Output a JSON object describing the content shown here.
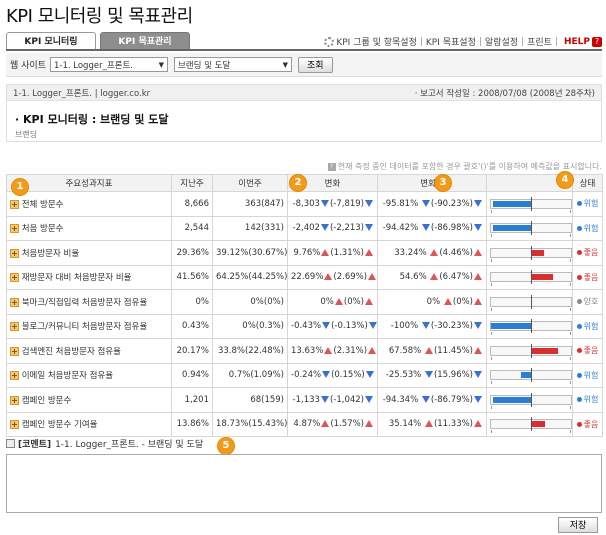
{
  "page_title": "KPI 모니터링 및 목표관리",
  "tabs": [
    {
      "label": "KPI 모니터링",
      "active": true
    },
    {
      "label": "KPI 목표관리",
      "active": false
    }
  ],
  "toplinks": {
    "group_settings": "KPI 그룹 및 항목설정",
    "goal_settings": "KPI 목표설정",
    "alarm_settings": "알람설정",
    "print": "프린트",
    "help": "HELP",
    "help_icon": "?"
  },
  "filter": {
    "site_label": "웹 사이트",
    "site_value": "1-1. Logger_프론트.",
    "category_value": "브랜딩 및 도달",
    "query_button": "조회"
  },
  "report": {
    "site_line": "1-1. Logger_프론트.  |  logger.co.kr",
    "date_line": "· 보고서 작성일 : 2008/07/08 (2008년 28주차)",
    "title": "· KPI 모니터링 : 브랜딩 및 도달",
    "subtitle": "브랜딩"
  },
  "note": "현재 측정 중인 데이터를 포함한 경우 괄호'()'를 이용하여 예측값을 표시합니다.",
  "note_icon": "!",
  "table": {
    "headers": [
      "주요성과지표",
      "지난주",
      "이번주",
      "변화",
      "변화율",
      "",
      "상태"
    ],
    "rows": [
      {
        "name": "전체 방문수",
        "prev": "8,666",
        "curr": "363(847)",
        "change": "-8,303",
        "change_pred": "(-7,819)",
        "rate": "-95.81%",
        "rate_pred": "(-90.23%)",
        "dir": "down",
        "bar": -0.96,
        "status": "위험"
      },
      {
        "name": "처음 방문수",
        "prev": "2,544",
        "curr": "142(331)",
        "change": "-2,402",
        "change_pred": "(-2,213)",
        "rate": "-94.42%",
        "rate_pred": "(-86.98%)",
        "dir": "down",
        "bar": -0.94,
        "status": "위험"
      },
      {
        "name": "처음방문자 비율",
        "prev": "29.36%",
        "curr": "39.12%(30.67%)",
        "change": "9.76%",
        "change_pred": "(1.31%)",
        "rate": "33.24%",
        "rate_pred": "(4.46%)",
        "dir": "up",
        "bar": 0.33,
        "status": "좋음"
      },
      {
        "name": "재방문자 대비 처음방문자 비율",
        "prev": "41.56%",
        "curr": "64.25%(44.25%)",
        "change": "22.69%",
        "change_pred": "(2.69%)",
        "rate": "54.6%",
        "rate_pred": "(6.47%)",
        "dir": "up",
        "bar": 0.55,
        "status": "좋음"
      },
      {
        "name": "북마크/직접입력 처음방문자 점유율",
        "prev": "0%",
        "curr": "0%(0%)",
        "change": "0%",
        "change_pred": "(0%)",
        "rate": "0%",
        "rate_pred": "(0%)",
        "dir": "flat",
        "bar": 0,
        "status": "양호"
      },
      {
        "name": "블로그/커뮤니티 처음방문자 점유율",
        "prev": "0.43%",
        "curr": "0%(0.3%)",
        "change": "-0.43%",
        "change_pred": "(-0.13%)",
        "rate": "-100%",
        "rate_pred": "(-30.23%)",
        "dir": "down",
        "bar": -1.0,
        "status": "위험"
      },
      {
        "name": "검색엔진 처음방문자 점유율",
        "prev": "20.17%",
        "curr": "33.8%(22.48%)",
        "change": "13.63%",
        "change_pred": "(2.31%)",
        "rate": "67.58%",
        "rate_pred": "(11.45%)",
        "dir": "up",
        "bar": 0.68,
        "status": "좋음"
      },
      {
        "name": "이메일 처음방문자 점유율",
        "prev": "0.94%",
        "curr": "0.7%(1.09%)",
        "change": "-0.24%",
        "change_pred": "(0.15%)",
        "rate": "-25.53%",
        "rate_pred": "(15.96%)",
        "dir": "down",
        "bar": -0.26,
        "status": "위험"
      },
      {
        "name": "캠페인 방문수",
        "prev": "1,201",
        "curr": "68(159)",
        "change": "-1,133",
        "change_pred": "(-1,042)",
        "rate": "-94.34%",
        "rate_pred": "(-86.79%)",
        "dir": "down",
        "bar": -0.94,
        "status": "위험"
      },
      {
        "name": "캠페인 방문수 기여율",
        "prev": "13.86%",
        "curr": "18.73%(15.43%)",
        "change": "4.87%",
        "change_pred": "(1.57%)",
        "rate": "35.14%",
        "rate_pred": "(11.33%)",
        "dir": "up",
        "bar": 0.35,
        "status": "좋음"
      }
    ]
  },
  "status_colors": {
    "위험": "#2a7fd4",
    "좋음": "#d83030",
    "양호": "#888888"
  },
  "bar_colors": {
    "up": "#d83030",
    "down": "#2a7fd4"
  },
  "badges": [
    "1",
    "2",
    "3",
    "4",
    "5"
  ],
  "comment": {
    "label": "[코멘트]",
    "subject": "1-1. Logger_프론트. - 브랜딩 및 도달",
    "save_button": "저장"
  }
}
